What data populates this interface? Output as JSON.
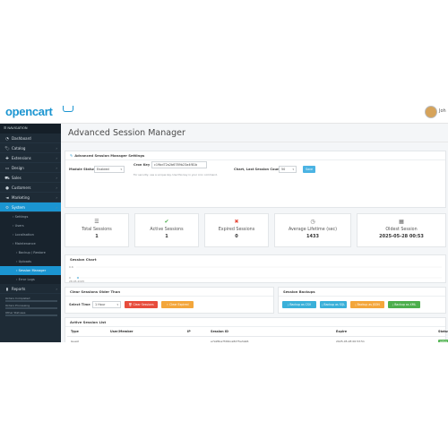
{
  "header": {
    "logo_text": "opencart",
    "user_name": "Joh"
  },
  "sidebar": {
    "heading": "NAVIGATION",
    "items": [
      {
        "icon": "dashboard-icon",
        "glyph": "◔",
        "label": "Dashboard",
        "chevron": false
      },
      {
        "icon": "tag-icon",
        "glyph": "🏷",
        "label": "Catalog",
        "chevron": true
      },
      {
        "icon": "puzzle-icon",
        "glyph": "✚",
        "label": "Extensions",
        "chevron": true
      },
      {
        "icon": "desktop-icon",
        "glyph": "▭",
        "label": "Design",
        "chevron": true
      },
      {
        "icon": "cart-icon",
        "glyph": "⛟",
        "label": "Sales",
        "chevron": true
      },
      {
        "icon": "user-icon",
        "glyph": "●",
        "label": "Customers",
        "chevron": true
      },
      {
        "icon": "share-icon",
        "glyph": "◄",
        "label": "Marketing",
        "chevron": true
      },
      {
        "icon": "cog-icon",
        "glyph": "⚙",
        "label": "System",
        "chevron": true
      }
    ],
    "sub_items": [
      {
        "label": "Settings",
        "level": 1
      },
      {
        "label": "Users",
        "level": 1
      },
      {
        "label": "Localisation",
        "level": 1
      },
      {
        "label": "Maintenance",
        "level": 1
      },
      {
        "label": "Backup / Restore",
        "level": 2
      },
      {
        "label": "Uploads",
        "level": 2
      },
      {
        "label": "Session Manager",
        "level": 2
      },
      {
        "label": "Error Logs",
        "level": 2
      }
    ],
    "reports_label": "Reports",
    "progress": [
      {
        "label": "Orders Completed",
        "value": 0.0
      },
      {
        "label": "Orders Processing",
        "value": 0.0
      },
      {
        "label": "Other Statuses",
        "value": 0.0
      }
    ]
  },
  "page": {
    "title": "Advanced Session Manager"
  },
  "settings": {
    "title": "Advanced Session Manager Settings",
    "module_status_label": "Module Status",
    "module_status_value": "Enabled",
    "cron_key_label": "Cron Key",
    "cron_key_value": "c19bd72a2b6789b23a4f81b",
    "cron_hint": "For security, use a unique key. Use this key in your cron command.",
    "chart_count_label": "Chart, Last Session Count",
    "chart_count_value": "50",
    "save_label": "Save"
  },
  "stats": [
    {
      "icon": "list-icon",
      "glyph": "☰",
      "color": "#666666",
      "label": "Total Sessions",
      "value": "1"
    },
    {
      "icon": "check-circle-icon",
      "glyph": "✔",
      "color": "#4cae4c",
      "label": "Active Sessions",
      "value": "1"
    },
    {
      "icon": "times-circle-icon",
      "glyph": "✖",
      "color": "#e74c3c",
      "label": "Expired Sessions",
      "value": "0"
    },
    {
      "icon": "clock-icon",
      "glyph": "◷",
      "color": "#666666",
      "label": "Average Lifetime (sec)",
      "value": "1433"
    },
    {
      "icon": "calendar-icon",
      "glyph": "▦",
      "color": "#666666",
      "label": "Oldest Session",
      "value": "2025-05-28 00:53"
    }
  ],
  "chart_data": {
    "type": "line",
    "title": "Session Chart",
    "y_ticks": [
      "0.6",
      "0"
    ],
    "x_ticks": [
      "28.05.2025"
    ],
    "series": [
      {
        "values": [
          1
        ]
      }
    ]
  },
  "clear": {
    "title": "Clear Sessions Older Than",
    "select_label": "Select Time",
    "select_value": "1 Hour",
    "clear_label": "Clear Sessions",
    "clear_expired_label": "Clear Expired"
  },
  "backups": {
    "title": "Session Backups",
    "buttons": [
      {
        "label": "Backup as CSV",
        "color": "#3ab0d9"
      },
      {
        "label": "Backup as SQL",
        "color": "#3ab0d9"
      },
      {
        "label": "Backup as JSON",
        "color": "#f3a63b"
      },
      {
        "label": "Backup as XML",
        "color": "#4cae4c"
      }
    ]
  },
  "active_list": {
    "title": "Active Session List",
    "columns": [
      "Type",
      "User/Member",
      "IP",
      "Session ID",
      "Expire",
      "Status"
    ],
    "rows": [
      {
        "type": "Guest",
        "user": "",
        "ip": "",
        "session_id": "e7a95ba7fd6bca8d75e3a96",
        "expire": "2025-05-28 00:53:51",
        "status": "Active"
      }
    ]
  }
}
